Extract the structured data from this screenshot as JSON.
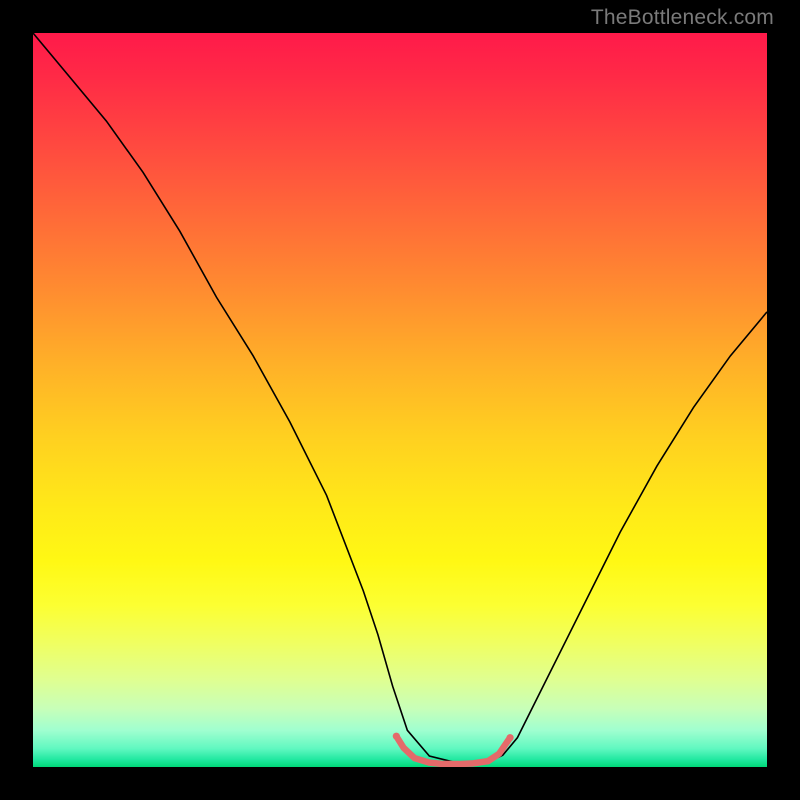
{
  "watermark": "TheBottleneck.com",
  "chart_data": {
    "type": "line",
    "title": "",
    "xlabel": "",
    "ylabel": "",
    "xlim": [
      0,
      100
    ],
    "ylim": [
      0,
      100
    ],
    "grid": false,
    "series": [
      {
        "name": "black-curve",
        "color": "#000000",
        "stroke_width": 1.6,
        "x": [
          0,
          5,
          10,
          15,
          20,
          25,
          30,
          35,
          40,
          45,
          47,
          49,
          51,
          54,
          58,
          62,
          64,
          66,
          70,
          75,
          80,
          85,
          90,
          95,
          100
        ],
        "y": [
          100,
          94,
          88,
          81,
          73,
          64,
          56,
          47,
          37,
          24,
          18,
          11,
          5,
          1.5,
          0.5,
          0.7,
          1.6,
          4,
          12,
          22,
          32,
          41,
          49,
          56,
          62
        ]
      },
      {
        "name": "red-highlight",
        "color": "#e46a6a",
        "stroke_width": 6.5,
        "round_caps": true,
        "x": [
          49.5,
          50.5,
          52,
          54,
          56,
          58,
          60,
          62,
          63.5,
          65
        ],
        "y": [
          4.2,
          2.6,
          1.2,
          0.6,
          0.4,
          0.4,
          0.5,
          0.8,
          1.8,
          4.0
        ]
      }
    ]
  }
}
